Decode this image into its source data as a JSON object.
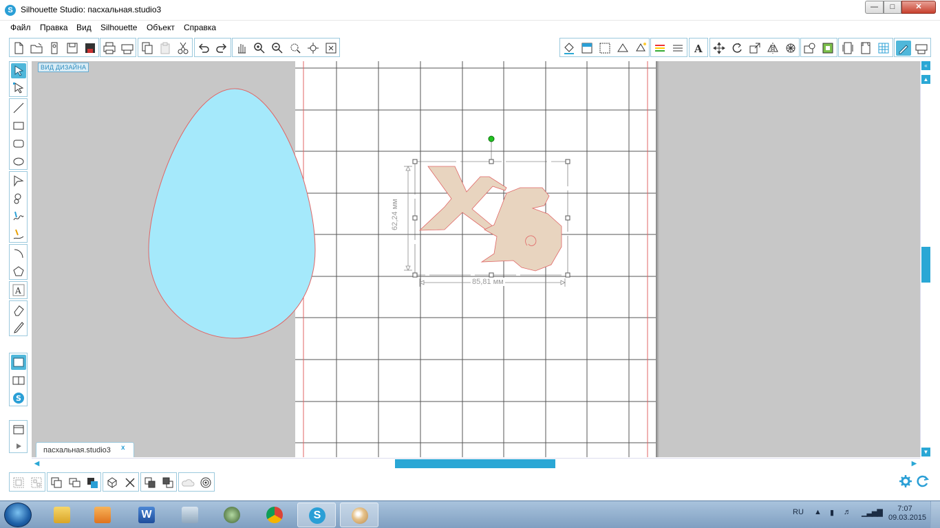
{
  "window": {
    "title": "Silhouette Studio: пасхальная.studio3",
    "app_icon": "S"
  },
  "menu": [
    "Файл",
    "Правка",
    "Вид",
    "Silhouette",
    "Объект",
    "Справка"
  ],
  "canvas": {
    "view_label": "ВИД ДИЗАЙНА",
    "height_dimension": "62,24 мм",
    "width_dimension": "85,81 мм",
    "selected_object_text": "ХВ",
    "egg_fill": "#a5e9fb",
    "letters_fill": "#e8d4bf",
    "cut_line_color": "#e06666"
  },
  "document_tab": {
    "name": "пасхальная.studio3",
    "close": "x"
  },
  "taskbar": {
    "language": "RU",
    "time": "7:07",
    "date": "09.03.2015"
  },
  "colors": {
    "accent": "#2aa7d5",
    "canvas_bg": "#c7c7c7"
  }
}
